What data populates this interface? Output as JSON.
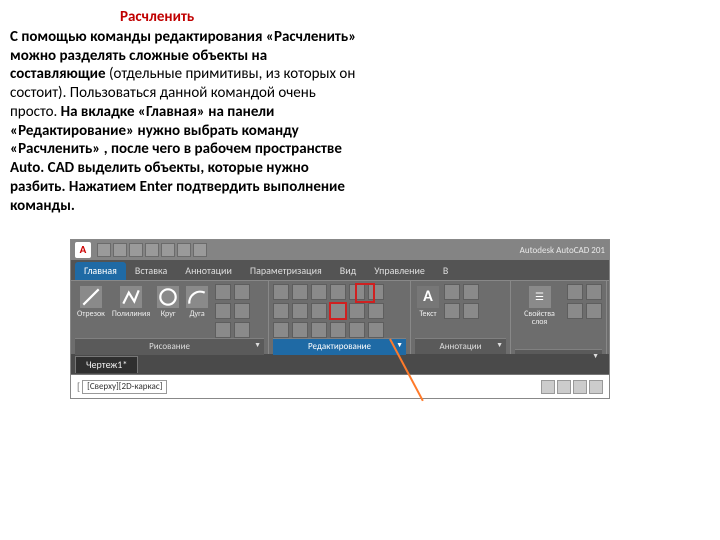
{
  "heading": "Расчленить",
  "paragraph_bold1": "С помощью команды редактирования «Расчленить» можно разделять сложные объекты на составляющие ",
  "paragraph_plain": "(отдельные примитивы, из которых он состоит). Пользоваться данной командой очень просто. ",
  "paragraph_bold2": "На вкладке «Главная» на панели «Редактирование» нужно выбрать команду «Расчленить» , после чего в рабочем пространстве Auto. CAD выделить объекты, которые нужно разбить. Нажатием Enter подтвердить выполнение команды.",
  "autocad": {
    "app_logo": "A",
    "title_right": "Autodesk AutoCAD 201",
    "tabs": [
      "Главная",
      "Вставка",
      "Аннотации",
      "Параметризация",
      "Вид",
      "Управление",
      "В"
    ],
    "active_tab": 0,
    "draw_panel": {
      "label": "Рисование",
      "buttons": [
        "Отрезок",
        "Полилиния",
        "Круг",
        "Дуга"
      ]
    },
    "edit_panel": {
      "label": "Редактирование"
    },
    "anno_panel": {
      "label": "Аннотации",
      "text_btn": "Текст",
      "big_A": "A"
    },
    "prop_panel": {
      "label": "Свойства слоя",
      "top": "☰"
    },
    "doc_tab": "Чертеж1*",
    "view_control": "[Сверху][2D-каркас]"
  }
}
